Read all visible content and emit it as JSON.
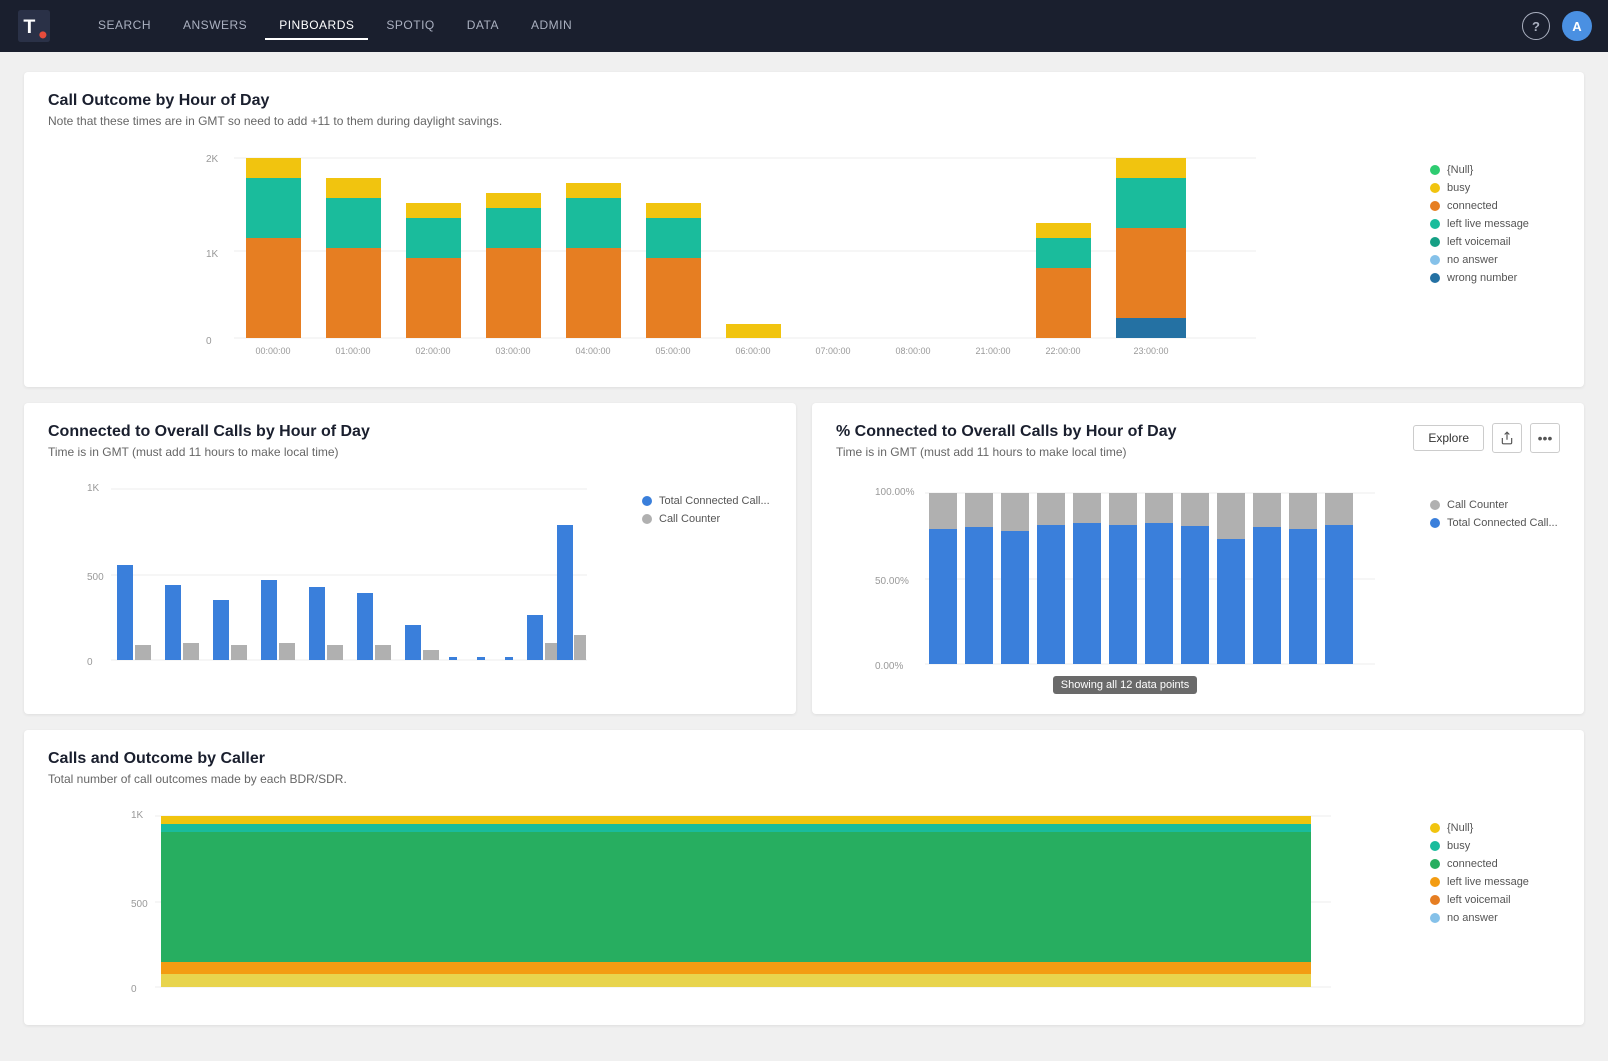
{
  "app": {
    "logo_text": "T",
    "help_label": "?",
    "avatar_label": "A"
  },
  "nav": {
    "items": [
      {
        "label": "SEARCH",
        "active": false
      },
      {
        "label": "ANSWERS",
        "active": false
      },
      {
        "label": "PINBOARDS",
        "active": true
      },
      {
        "label": "SPOTIQ",
        "active": false
      },
      {
        "label": "DATA",
        "active": false
      },
      {
        "label": "ADMIN",
        "active": false
      }
    ]
  },
  "chart1": {
    "title": "Call Outcome by Hour of Day",
    "subtitle": "Note that these times are in GMT so need to add +11 to them during daylight savings.",
    "y_max": "2K",
    "y_mid": "1K",
    "y_min": "0",
    "x_labels": [
      "00:00:00",
      "01:00:00",
      "02:00:00",
      "03:00:00",
      "04:00:00",
      "05:00:00",
      "06:00:00",
      "07:00:00",
      "08:00:00",
      "21:00:00",
      "22:00:00",
      "23:00:00"
    ],
    "legend": [
      {
        "label": "{Null}",
        "color": "#2ecc71"
      },
      {
        "label": "busy",
        "color": "#f1c40f"
      },
      {
        "label": "connected",
        "color": "#e67e22"
      },
      {
        "label": "left live message",
        "color": "#1abc9c"
      },
      {
        "label": "left voicemail",
        "color": "#16a085"
      },
      {
        "label": "no answer",
        "color": "#85c1e9"
      },
      {
        "label": "wrong number",
        "color": "#2471a3"
      }
    ]
  },
  "chart2": {
    "title": "Connected to Overall Calls by Hour of Day",
    "subtitle": "Time is in GMT (must add 11 hours to make local time)",
    "y_max": "1K",
    "y_mid": "500",
    "y_min": "0",
    "legend": [
      {
        "label": "Total Connected Call...",
        "color": "#3a7fdb"
      },
      {
        "label": "Call Counter",
        "color": "#b0b0b0"
      }
    ]
  },
  "chart3": {
    "title": "% Connected to Overall Calls by Hour of Day",
    "subtitle": "Time is in GMT (must add 11 hours to make local time)",
    "y_max": "100.00%",
    "y_mid": "50.00%",
    "y_min": "0.00%",
    "legend": [
      {
        "label": "Call Counter",
        "color": "#b0b0b0"
      },
      {
        "label": "Total Connected Call...",
        "color": "#3a7fdb"
      }
    ],
    "showing_label": "Showing all 12 data points",
    "actions": {
      "explore": "Explore",
      "share_icon": "share",
      "more_icon": "more"
    }
  },
  "chart4": {
    "title": "Calls and Outcome by Caller",
    "subtitle": "Total number of call outcomes made by each BDR/SDR.",
    "y_max": "1K",
    "y_mid": "500",
    "y_min": "0",
    "legend": [
      {
        "label": "{Null}",
        "color": "#f1c40f"
      },
      {
        "label": "busy",
        "color": "#1abc9c"
      },
      {
        "label": "connected",
        "color": "#27ae60"
      },
      {
        "label": "left live message",
        "color": "#f39c12"
      },
      {
        "label": "left voicemail",
        "color": "#e67e22"
      },
      {
        "label": "no answer",
        "color": "#85c1e9"
      }
    ]
  }
}
